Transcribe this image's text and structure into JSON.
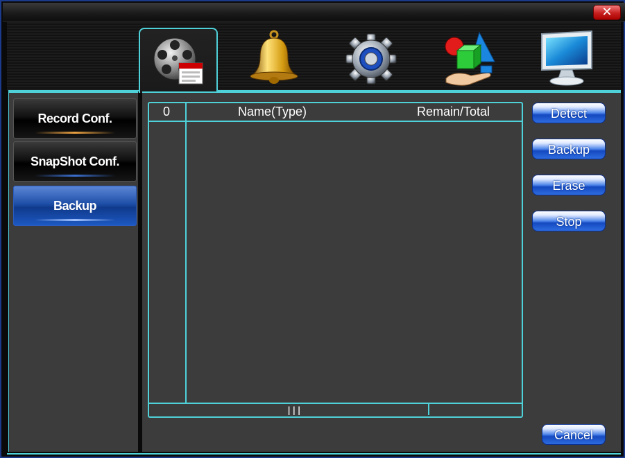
{
  "window": {
    "close_label": "✕"
  },
  "toolbar": {
    "tabs": [
      {
        "icon": "film-reel-icon",
        "active": true
      },
      {
        "icon": "bell-icon",
        "active": false
      },
      {
        "icon": "gear-icon",
        "active": false
      },
      {
        "icon": "shapes-icon",
        "active": false
      },
      {
        "icon": "monitor-icon",
        "active": false
      }
    ]
  },
  "sidebar": {
    "items": [
      {
        "label": "Record Conf.",
        "active": false
      },
      {
        "label": "SnapShot Conf.",
        "active": false
      },
      {
        "label": "Backup",
        "active": true
      }
    ]
  },
  "table": {
    "col_index": "0",
    "col_name": "Name(Type)",
    "col_remain": "Remain/Total",
    "rows": [],
    "scroll_grip": "|||"
  },
  "actions": {
    "detect": "Detect",
    "backup": "Backup",
    "erase": "Erase",
    "stop": "Stop",
    "cancel": "Cancel"
  },
  "colors": {
    "accent": "#4fd1d9",
    "active_blue": "#1e4fa8",
    "close_red": "#c71f1f"
  }
}
